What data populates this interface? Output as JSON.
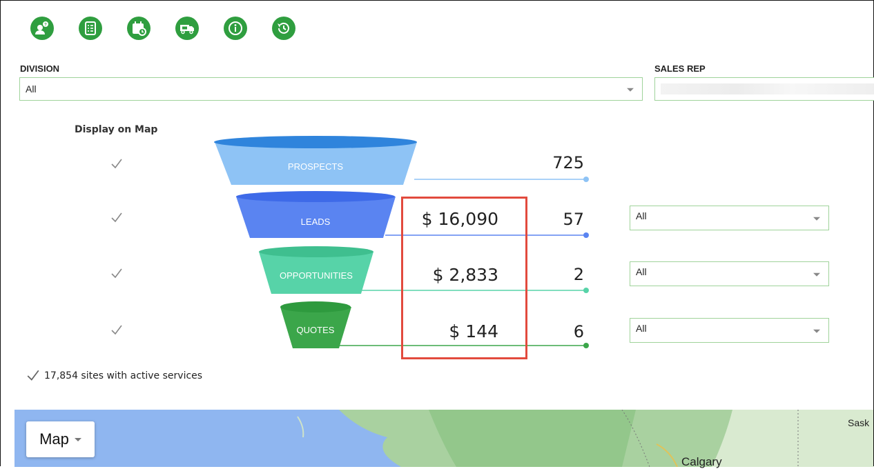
{
  "toolbar": {
    "icons": [
      "user-help-icon",
      "checklist-icon",
      "calendar-icon",
      "truck-icon",
      "info-icon",
      "history-icon"
    ]
  },
  "filters": {
    "division_label": "DIVISION",
    "division_value": "All",
    "sales_rep_label": "SALES REP"
  },
  "funnel": {
    "display_title": "Display on Map",
    "stages": [
      {
        "label": "PROSPECTS",
        "count": "725",
        "amount": "",
        "filter": "",
        "color": "#8ec3f5"
      },
      {
        "label": "LEADS",
        "count": "57",
        "amount": "$ 16,090",
        "filter": "All",
        "color": "#5a84f1"
      },
      {
        "label": "OPPORTUNITIES",
        "count": "2",
        "amount": "$ 2,833",
        "filter": "All",
        "color": "#57d3a8"
      },
      {
        "label": "QUOTES",
        "count": "6",
        "amount": "$ 144",
        "filter": "All",
        "color": "#3ba64a"
      }
    ]
  },
  "sites": {
    "label": "17,854 sites with active services"
  },
  "map": {
    "type_button": "Map",
    "cities": [
      "Calgary",
      "Sask"
    ]
  },
  "colors": {
    "accent_green": "#2f9e3f",
    "highlight_red": "#e24a3d",
    "input_border": "#9fd39a"
  }
}
